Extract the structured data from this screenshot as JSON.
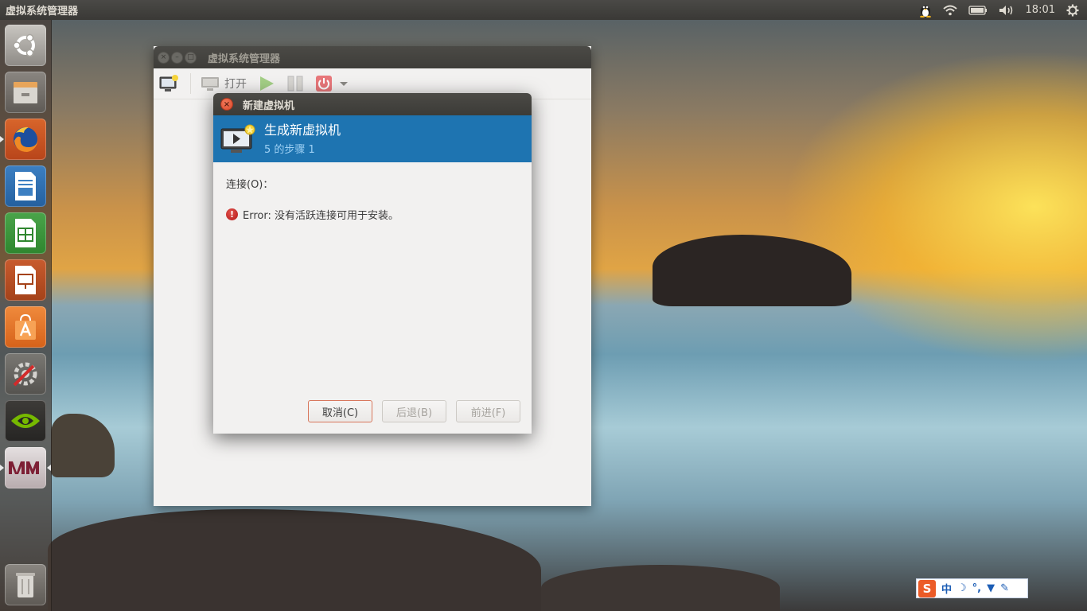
{
  "top_panel": {
    "app_title": "虚拟系统管理器",
    "clock": "18:01",
    "indicators": [
      "tux-icon",
      "wifi-icon",
      "battery-icon",
      "volume-icon",
      "gear-icon"
    ]
  },
  "launcher": {
    "items": [
      {
        "name": "ubuntu-dash",
        "icon": "ubuntu-logo-icon"
      },
      {
        "name": "files",
        "icon": "file-cabinet-icon"
      },
      {
        "name": "firefox",
        "icon": "firefox-icon"
      },
      {
        "name": "libreoffice-writer",
        "icon": "writer-icon"
      },
      {
        "name": "libreoffice-calc",
        "icon": "calc-icon"
      },
      {
        "name": "libreoffice-impress",
        "icon": "impress-icon"
      },
      {
        "name": "software-center",
        "icon": "shopping-bag-icon"
      },
      {
        "name": "system-settings",
        "icon": "settings-wrench-icon"
      },
      {
        "name": "nvidia-settings",
        "icon": "nvidia-icon"
      },
      {
        "name": "virt-manager",
        "icon": "vmm-icon",
        "label": "VM"
      },
      {
        "name": "trash",
        "icon": "trash-icon"
      }
    ]
  },
  "main_window": {
    "title": "虚拟系统管理器",
    "toolbar": {
      "open_label": "打开"
    }
  },
  "dialog": {
    "title": "新建虚拟机",
    "banner_title": "生成新虚拟机",
    "banner_subtitle": "5 的步骤 1",
    "connection_label": "连接(O)：",
    "error_text": "Error: 没有活跃连接可用于安装。",
    "buttons": {
      "cancel": "取消(C)",
      "back": "后退(B)",
      "forward": "前进(F)"
    }
  },
  "ime": {
    "logo": "S",
    "mode": "中"
  },
  "colors": {
    "banner": "#1e74b1",
    "close_button": "#d9472a",
    "cancel_border": "#d8765b"
  }
}
